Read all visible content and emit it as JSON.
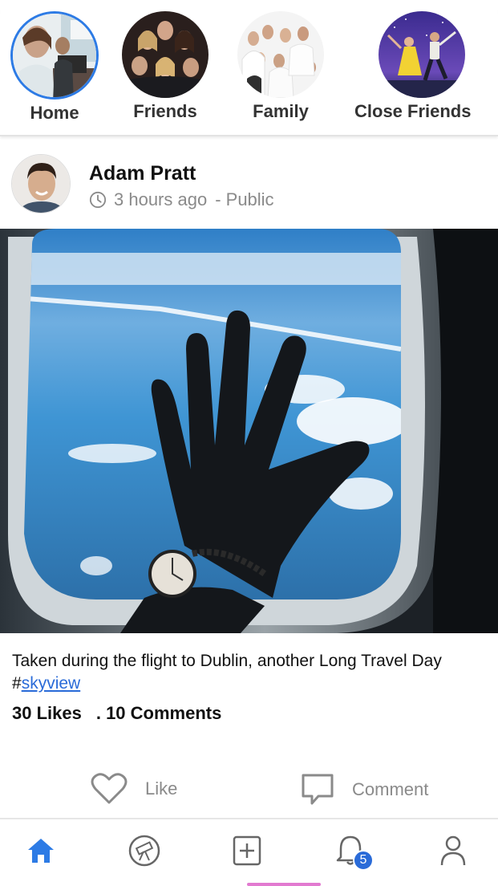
{
  "colors": {
    "accent": "#2d7be5",
    "link": "#2a6bd8",
    "muted": "#8a8a8a",
    "text": "#111111"
  },
  "groups": [
    {
      "label": "Home",
      "icon": "home-group-photo",
      "active": true
    },
    {
      "label": "Friends",
      "icon": "friends-group-photo",
      "active": false
    },
    {
      "label": "Family",
      "icon": "family-group-photo",
      "active": false
    },
    {
      "label": "Close Friends",
      "icon": "close-friends-group-photo",
      "active": false
    }
  ],
  "post": {
    "author": "Adam Pratt",
    "time": "3 hours ago",
    "visibility": "- Public",
    "caption_text": "Taken during the flight to Dublin, another Long Travel Day #",
    "hashtag": "skyview",
    "likes": "30 Likes",
    "comments": ". 10 Comments"
  },
  "actions": {
    "like_label": "Like",
    "comment_label": "Comment"
  },
  "nav": {
    "items": [
      "home-icon",
      "explore-icon",
      "add-post-icon",
      "notifications-icon",
      "profile-icon"
    ],
    "notification_count": "5"
  }
}
